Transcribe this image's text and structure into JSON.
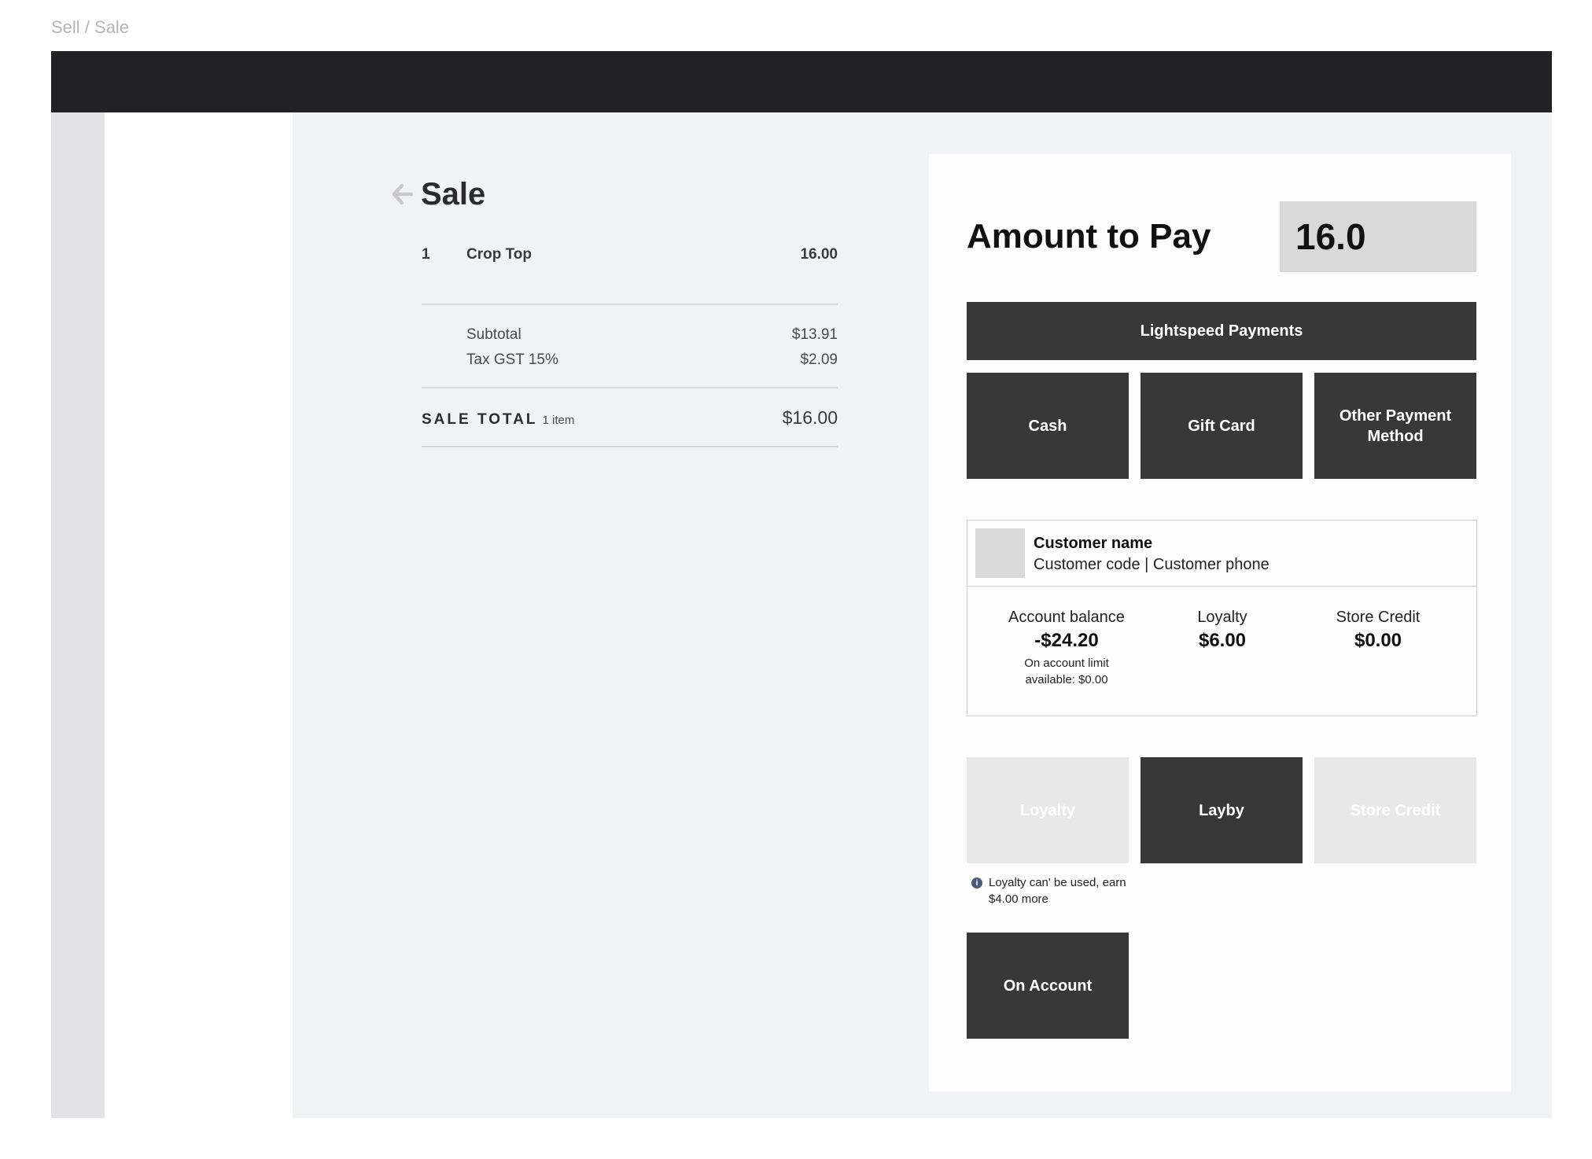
{
  "breadcrumb": "Sell / Sale",
  "sale": {
    "title": "Sale",
    "back_icon": "arrow-left-icon",
    "line_items": [
      {
        "qty": "1",
        "name": "Crop Top",
        "price": "16.00"
      }
    ],
    "subtotal_label": "Subtotal",
    "subtotal_value": "$13.91",
    "tax_label": "Tax GST 15%",
    "tax_value": "$2.09",
    "total_label": "SALE TOTAL",
    "total_count": "1 item",
    "total_value": "$16.00"
  },
  "payment": {
    "amount_label": "Amount to Pay",
    "amount_value": "16.0",
    "lightspeed_label": "Lightspeed Payments",
    "cash_label": "Cash",
    "gift_card_label": "Gift Card",
    "other_label": "Other Payment Method",
    "loyalty_label": "Loyalty",
    "layby_label": "Layby",
    "store_credit_label": "Store Credit",
    "on_account_label": "On Account",
    "loyalty_note": "Loyalty can' be used, earn $4.00 more",
    "info_icon": "info-icon"
  },
  "customer": {
    "name": "Customer name",
    "sub": "Customer code | Customer phone",
    "account_balance_label": "Account balance",
    "account_balance_value": "-$24.20",
    "account_limit_note": "On account limit available: $0.00",
    "loyalty_label": "Loyalty",
    "loyalty_value": "$6.00",
    "store_credit_label": "Store Credit",
    "store_credit_value": "$0.00"
  },
  "colors": {
    "topbar": "#222124",
    "button": "#383838",
    "button_disabled": "#e8e8e8",
    "content_bg": "#f1f2f6"
  }
}
